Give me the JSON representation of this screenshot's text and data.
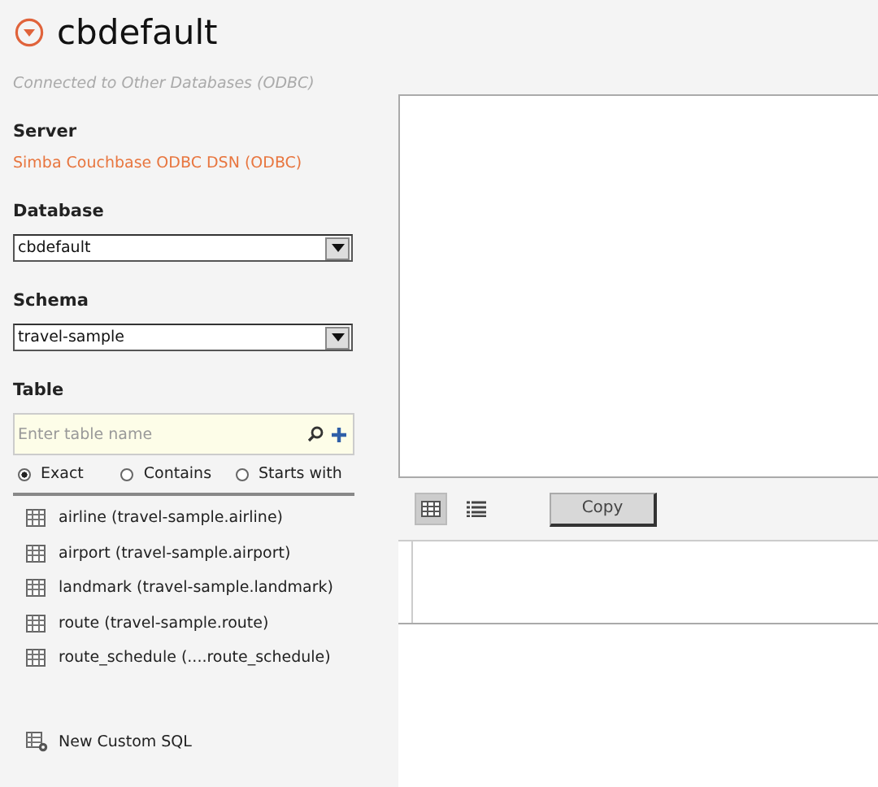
{
  "header": {
    "title": "cbdefault",
    "subtitle": "Connected to Other Databases (ODBC)"
  },
  "server": {
    "label": "Server",
    "value": "Simba Couchbase ODBC DSN (ODBC)"
  },
  "database": {
    "label": "Database",
    "value": "cbdefault"
  },
  "schema": {
    "label": "Schema",
    "value": "travel-sample"
  },
  "table": {
    "label": "Table",
    "search": {
      "placeholder": "Enter table name"
    },
    "match_options": [
      {
        "label": "Exact",
        "selected": true
      },
      {
        "label": "Contains",
        "selected": false
      },
      {
        "label": "Starts with",
        "selected": false
      }
    ],
    "items": [
      {
        "label": "airline (travel-sample.airline)"
      },
      {
        "label": "airport (travel-sample.airport)"
      },
      {
        "label": "landmark (travel-sample.landmark)"
      },
      {
        "label": "route (travel-sample.route)"
      },
      {
        "label": "route_schedule (....route_schedule)"
      }
    ]
  },
  "custom_sql": {
    "label": "New Custom SQL"
  },
  "toolbar": {
    "views": [
      {
        "kind": "grid",
        "selected": true
      },
      {
        "kind": "list",
        "selected": false
      }
    ],
    "copy_button": "Copy"
  }
}
